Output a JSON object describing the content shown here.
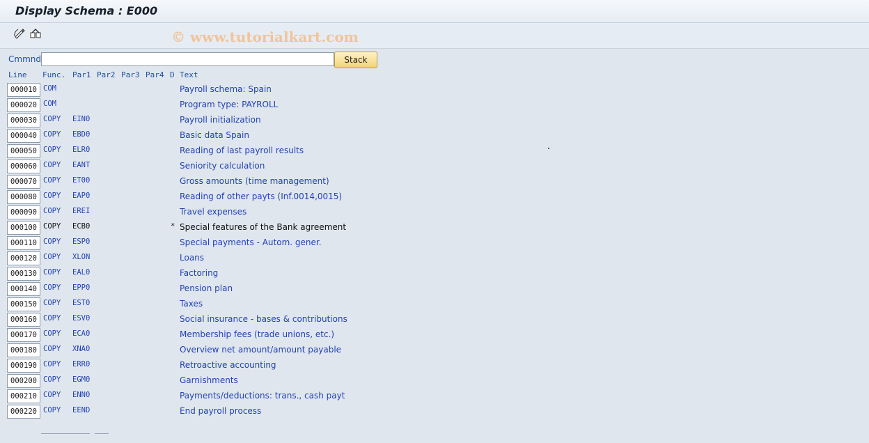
{
  "window": {
    "title": "Display Schema : E000"
  },
  "toolbar": {
    "watermark": "© www.tutorialkart.com",
    "icons": [
      "edit-icon",
      "other-object-icon"
    ]
  },
  "command": {
    "label": "Cmmnd",
    "value": "",
    "stack_label": "Stack"
  },
  "headers": {
    "line": "Line",
    "func": "Func.",
    "par1": "Par1",
    "par2": "Par2",
    "par3": "Par3",
    "par4": "Par4",
    "d": "D",
    "text": "Text"
  },
  "rows": [
    {
      "line": "000010",
      "func": "COM",
      "par1": "",
      "d": "",
      "text": "Payroll schema: Spain"
    },
    {
      "line": "000020",
      "func": "COM",
      "par1": "",
      "d": "",
      "text": "Program type: PAYROLL"
    },
    {
      "line": "000030",
      "func": "COPY",
      "par1": "EIN0",
      "d": "",
      "text": "Payroll initialization"
    },
    {
      "line": "000040",
      "func": "COPY",
      "par1": "EBD0",
      "d": "",
      "text": "Basic data Spain"
    },
    {
      "line": "000050",
      "func": "COPY",
      "par1": "ELR0",
      "d": "",
      "text": "Reading of last payroll results"
    },
    {
      "line": "000060",
      "func": "COPY",
      "par1": "EANT",
      "d": "",
      "text": "Seniority calculation"
    },
    {
      "line": "000070",
      "func": "COPY",
      "par1": "ET00",
      "d": "",
      "text": "Gross amounts (time management)"
    },
    {
      "line": "000080",
      "func": "COPY",
      "par1": "EAP0",
      "d": "",
      "text": "Reading of other payts (Inf.0014,0015)"
    },
    {
      "line": "000090",
      "func": "COPY",
      "par1": "EREI",
      "d": "",
      "text": "Travel expenses"
    },
    {
      "line": "000100",
      "func": "COPY",
      "par1": "ECB0",
      "d": "*",
      "text": "Special features of the Bank agreement"
    },
    {
      "line": "000110",
      "func": "COPY",
      "par1": "ESP0",
      "d": "",
      "text": "Special payments - Autom. gener."
    },
    {
      "line": "000120",
      "func": "COPY",
      "par1": "XLON",
      "d": "",
      "text": "Loans"
    },
    {
      "line": "000130",
      "func": "COPY",
      "par1": "EAL0",
      "d": "",
      "text": "Factoring"
    },
    {
      "line": "000140",
      "func": "COPY",
      "par1": "EPP0",
      "d": "",
      "text": "Pension plan"
    },
    {
      "line": "000150",
      "func": "COPY",
      "par1": "EST0",
      "d": "",
      "text": "Taxes"
    },
    {
      "line": "000160",
      "func": "COPY",
      "par1": "ESV0",
      "d": "",
      "text": "Social insurance - bases & contributions"
    },
    {
      "line": "000170",
      "func": "COPY",
      "par1": "ECA0",
      "d": "",
      "text": "Membership fees (trade unions, etc.)"
    },
    {
      "line": "000180",
      "func": "COPY",
      "par1": "XNA0",
      "d": "",
      "text": "Overview net amount/amount payable"
    },
    {
      "line": "000190",
      "func": "COPY",
      "par1": "ERR0",
      "d": "",
      "text": "Retroactive accounting"
    },
    {
      "line": "000200",
      "func": "COPY",
      "par1": "EGM0",
      "d": "",
      "text": "Garnishments"
    },
    {
      "line": "000210",
      "func": "COPY",
      "par1": "ENN0",
      "d": "",
      "text": "Payments/deductions: trans., cash payt"
    },
    {
      "line": "000220",
      "func": "COPY",
      "par1": "EEND",
      "d": "",
      "text": "End payroll process"
    }
  ]
}
